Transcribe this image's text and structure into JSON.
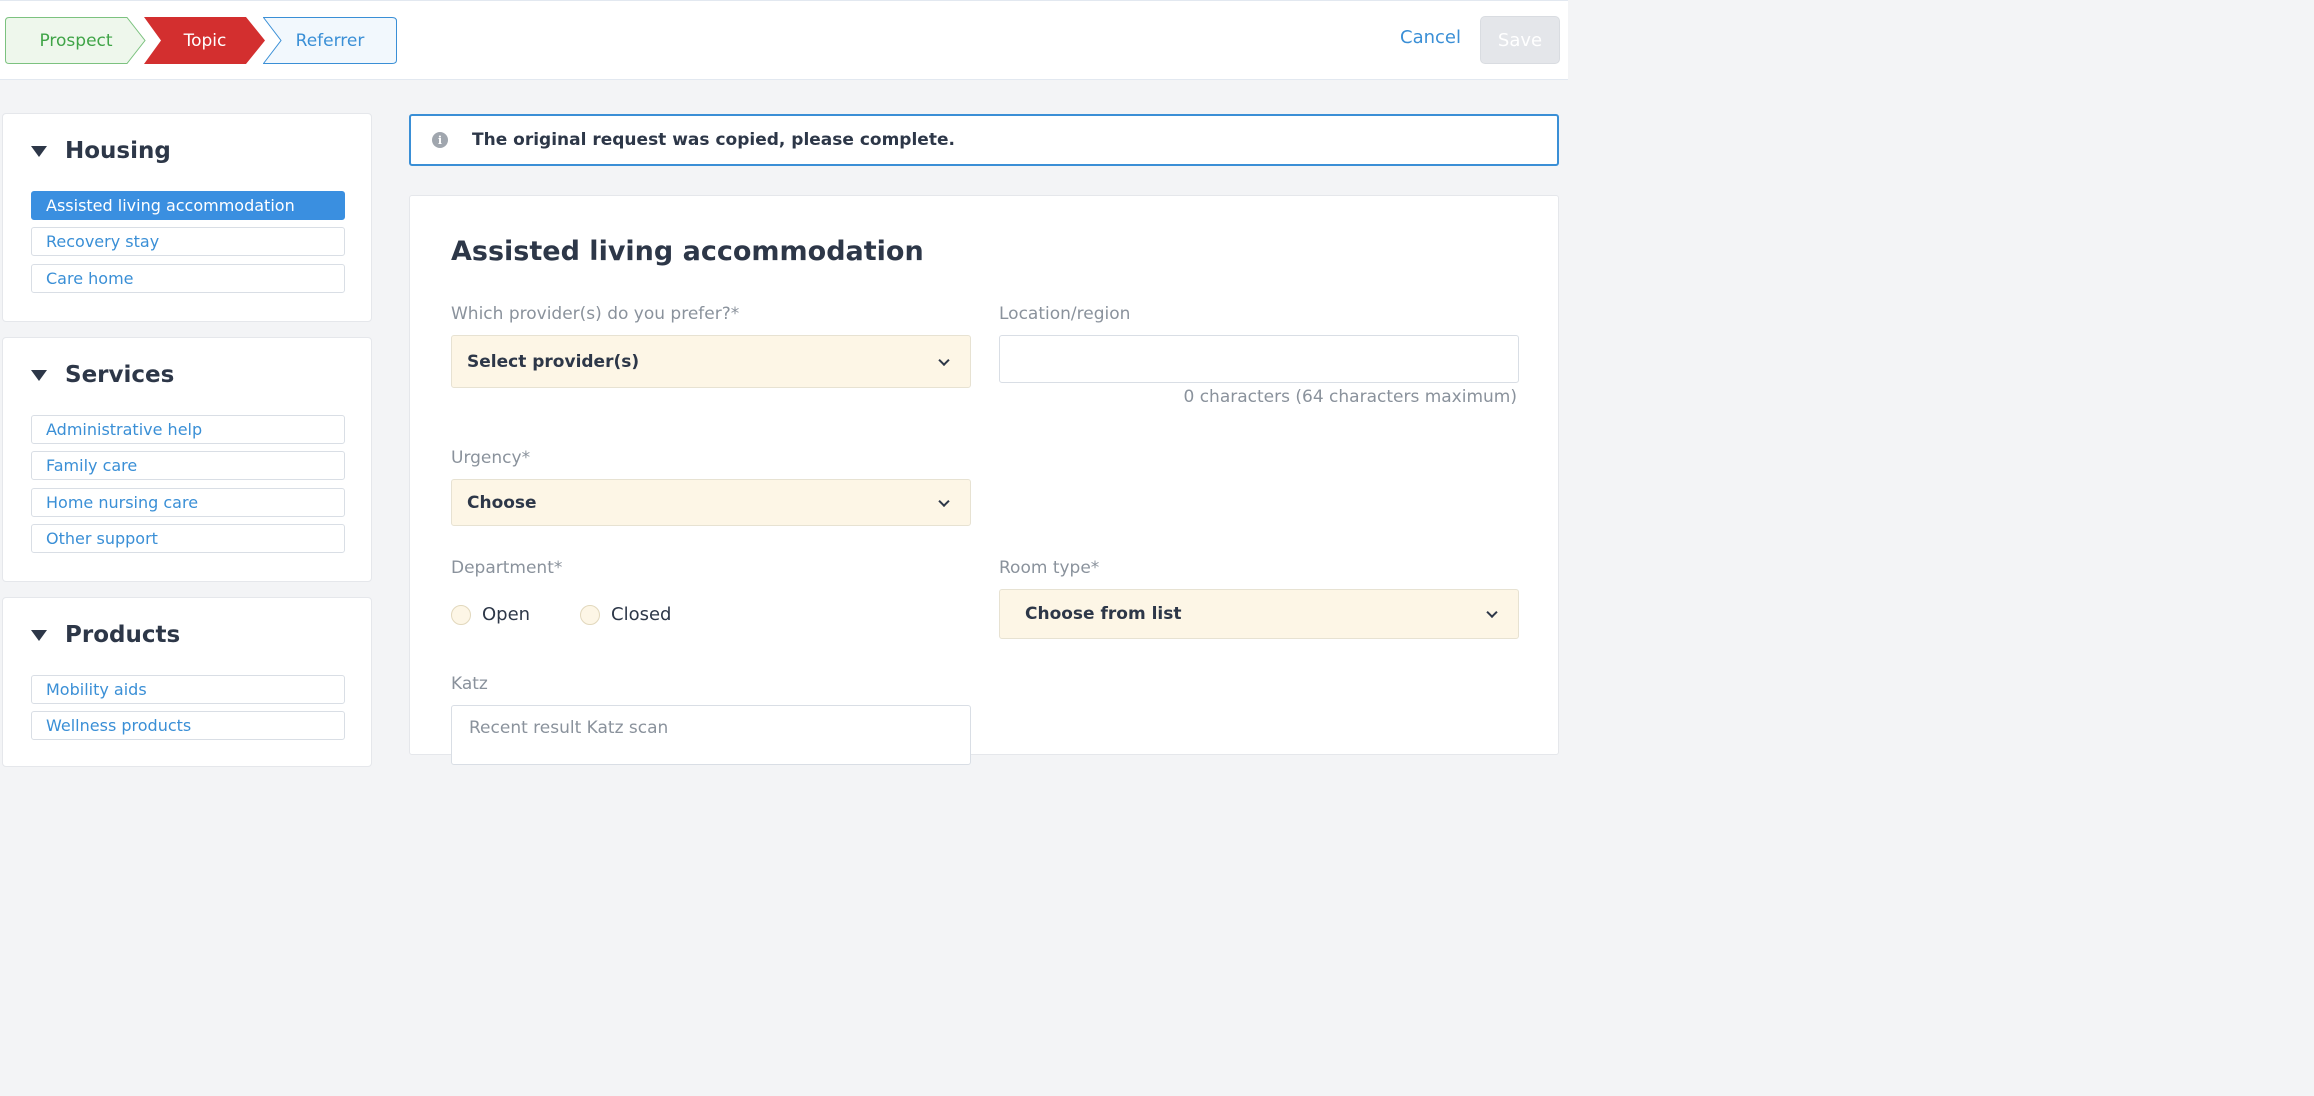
{
  "steps": {
    "prospect": "Prospect",
    "topic": "Topic",
    "referrer": "Referrer"
  },
  "actions": {
    "cancel": "Cancel",
    "save": "Save"
  },
  "sidebar": {
    "groups": [
      {
        "title": "Housing",
        "items": [
          "Assisted living accommodation",
          "Recovery stay",
          "Care home"
        ]
      },
      {
        "title": "Services",
        "items": [
          "Administrative help",
          "Family care",
          "Home nursing care",
          "Other support"
        ]
      },
      {
        "title": "Products",
        "items": [
          "Mobility aids",
          "Wellness products"
        ]
      }
    ]
  },
  "banner": {
    "icon": "info-icon",
    "text": "The original request was copied, please complete."
  },
  "form": {
    "title": "Assisted living accommodation",
    "provider": {
      "label": "Which provider(s) do you prefer?*",
      "value": "Select provider(s)"
    },
    "location": {
      "label": "Location/region",
      "value": "",
      "counter": "0 characters (64 characters maximum)"
    },
    "urgency": {
      "label": "Urgency*",
      "value": "Choose"
    },
    "department": {
      "label": "Department*",
      "options": [
        "Open",
        "Closed"
      ]
    },
    "room_type": {
      "label": "Room type*",
      "value": "Choose from list"
    },
    "katz": {
      "label": "Katz",
      "placeholder": "Recent result Katz scan"
    }
  },
  "colors": {
    "prospect": "#3fa447",
    "topic": "#d32f2f",
    "referrer": "#3a8fd6",
    "accent": "#3a8fe0",
    "select_bg": "#fdf6e6"
  }
}
